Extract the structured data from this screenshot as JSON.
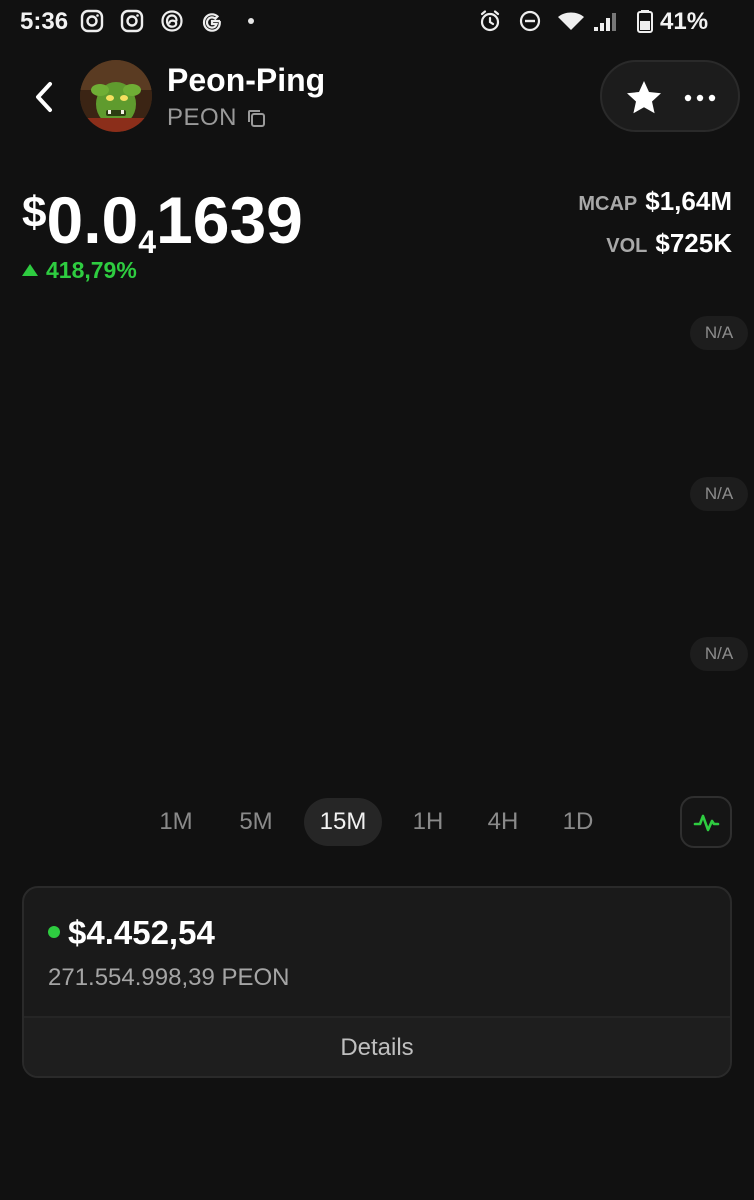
{
  "status_bar": {
    "time": "5:36",
    "battery": "41%",
    "left_icons": [
      "instagram-icon",
      "instagram-icon",
      "threads-icon",
      "google-icon"
    ],
    "right_icons": [
      "alarm-icon",
      "do-not-disturb-icon",
      "wifi-icon",
      "signal-icon",
      "battery-icon"
    ]
  },
  "header": {
    "token_name": "Peon-Ping",
    "token_symbol": "PEON"
  },
  "price": {
    "currency": "$",
    "main": "0.0",
    "subscript": "4",
    "rest": "1639",
    "change": "418,79%",
    "change_direction": "up"
  },
  "stats": [
    {
      "label": "MCAP",
      "value": "$1,64M"
    },
    {
      "label": "VOL",
      "value": "$725K"
    }
  ],
  "chart": {
    "axis_badges": [
      "N/A",
      "N/A",
      "N/A"
    ]
  },
  "timeframes": [
    "1M",
    "5M",
    "15M",
    "1H",
    "4H",
    "1D"
  ],
  "active_timeframe": "15M",
  "holdings": {
    "value": "$4.452,54",
    "amount": "271.554.998,39 PEON",
    "details_label": "Details"
  },
  "colors": {
    "background": "#111111",
    "positive": "#2ecc40",
    "muted": "#8a8a8a"
  }
}
